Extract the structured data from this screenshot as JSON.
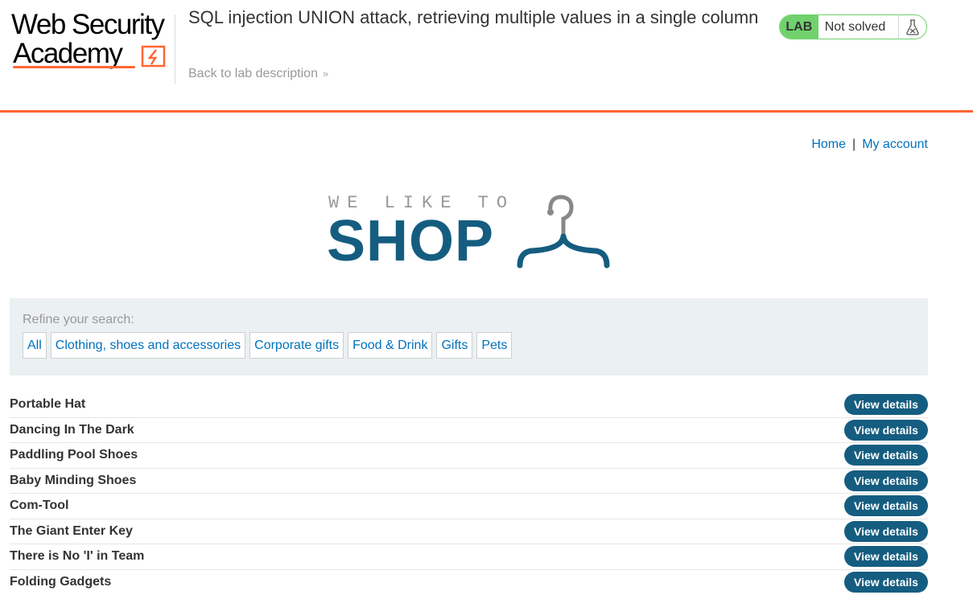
{
  "lab_header": {
    "logo": {
      "line1": "Web Security",
      "line2": "Academy"
    },
    "title": "SQL injection UNION attack, retrieving multiple values in a single column",
    "back_link": "Back to lab description",
    "back_chevron": "»",
    "status_badge": "LAB",
    "status_text": "Not solved",
    "status_icon": "flask-icon",
    "accent_color": "#ff6633",
    "badge_color": "#70d16d"
  },
  "nav": {
    "home": "Home",
    "separator": "|",
    "my_account": "My account"
  },
  "shop_logo": {
    "tagline": "WE LIKE TO",
    "name": "SHOP",
    "icon": "hanger-icon",
    "color": "#155d80"
  },
  "filters": {
    "label": "Refine your search:",
    "categories": [
      "All",
      "Clothing, shoes and accessories",
      "Corporate gifts",
      "Food & Drink",
      "Gifts",
      "Pets"
    ]
  },
  "products": {
    "button_label": "View details",
    "button_color": "#155d80",
    "items": [
      "Portable Hat",
      "Dancing In The Dark",
      "Paddling Pool Shoes",
      "Baby Minding Shoes",
      "Com-Tool",
      "The Giant Enter Key",
      "There is No 'I' in Team",
      "Folding Gadgets"
    ]
  }
}
